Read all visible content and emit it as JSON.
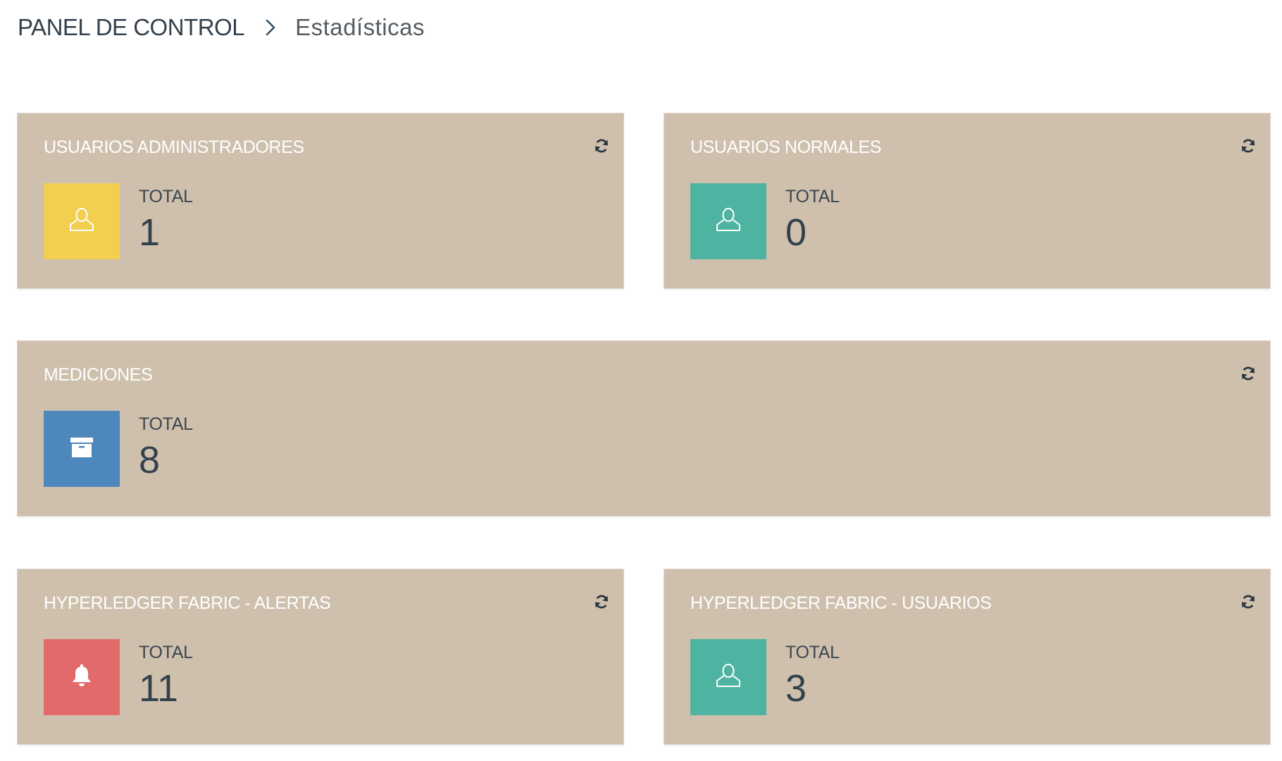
{
  "breadcrumb": {
    "root": "PANEL DE CONTROL",
    "separator_icon": "chevron-right-icon",
    "current": "Estadísticas"
  },
  "cards": {
    "admins": {
      "title": "USUARIOS ADMINISTRADORES",
      "label": "TOTAL",
      "value": "1",
      "icon": "user-icon",
      "color": "#f3cf4f"
    },
    "normal": {
      "title": "USUARIOS NORMALES",
      "label": "TOTAL",
      "value": "0",
      "icon": "user-icon",
      "color": "#4fb3a2"
    },
    "measurements": {
      "title": "MEDICIONES",
      "label": "TOTAL",
      "value": "8",
      "icon": "archive-icon",
      "color": "#4e87bb"
    },
    "hl_alerts": {
      "title": "HYPERLEDGER FABRIC - ALERTAS",
      "label": "TOTAL",
      "value": "11",
      "icon": "bell-icon",
      "color": "#e36a6b"
    },
    "hl_users": {
      "title": "HYPERLEDGER FABRIC - USUARIOS",
      "label": "TOTAL",
      "value": "3",
      "icon": "user-icon",
      "color": "#4fb3a2"
    }
  },
  "colors": {
    "card_background": "#cfc0ad",
    "text_dark": "#34414c",
    "title_text": "#ffffff"
  }
}
